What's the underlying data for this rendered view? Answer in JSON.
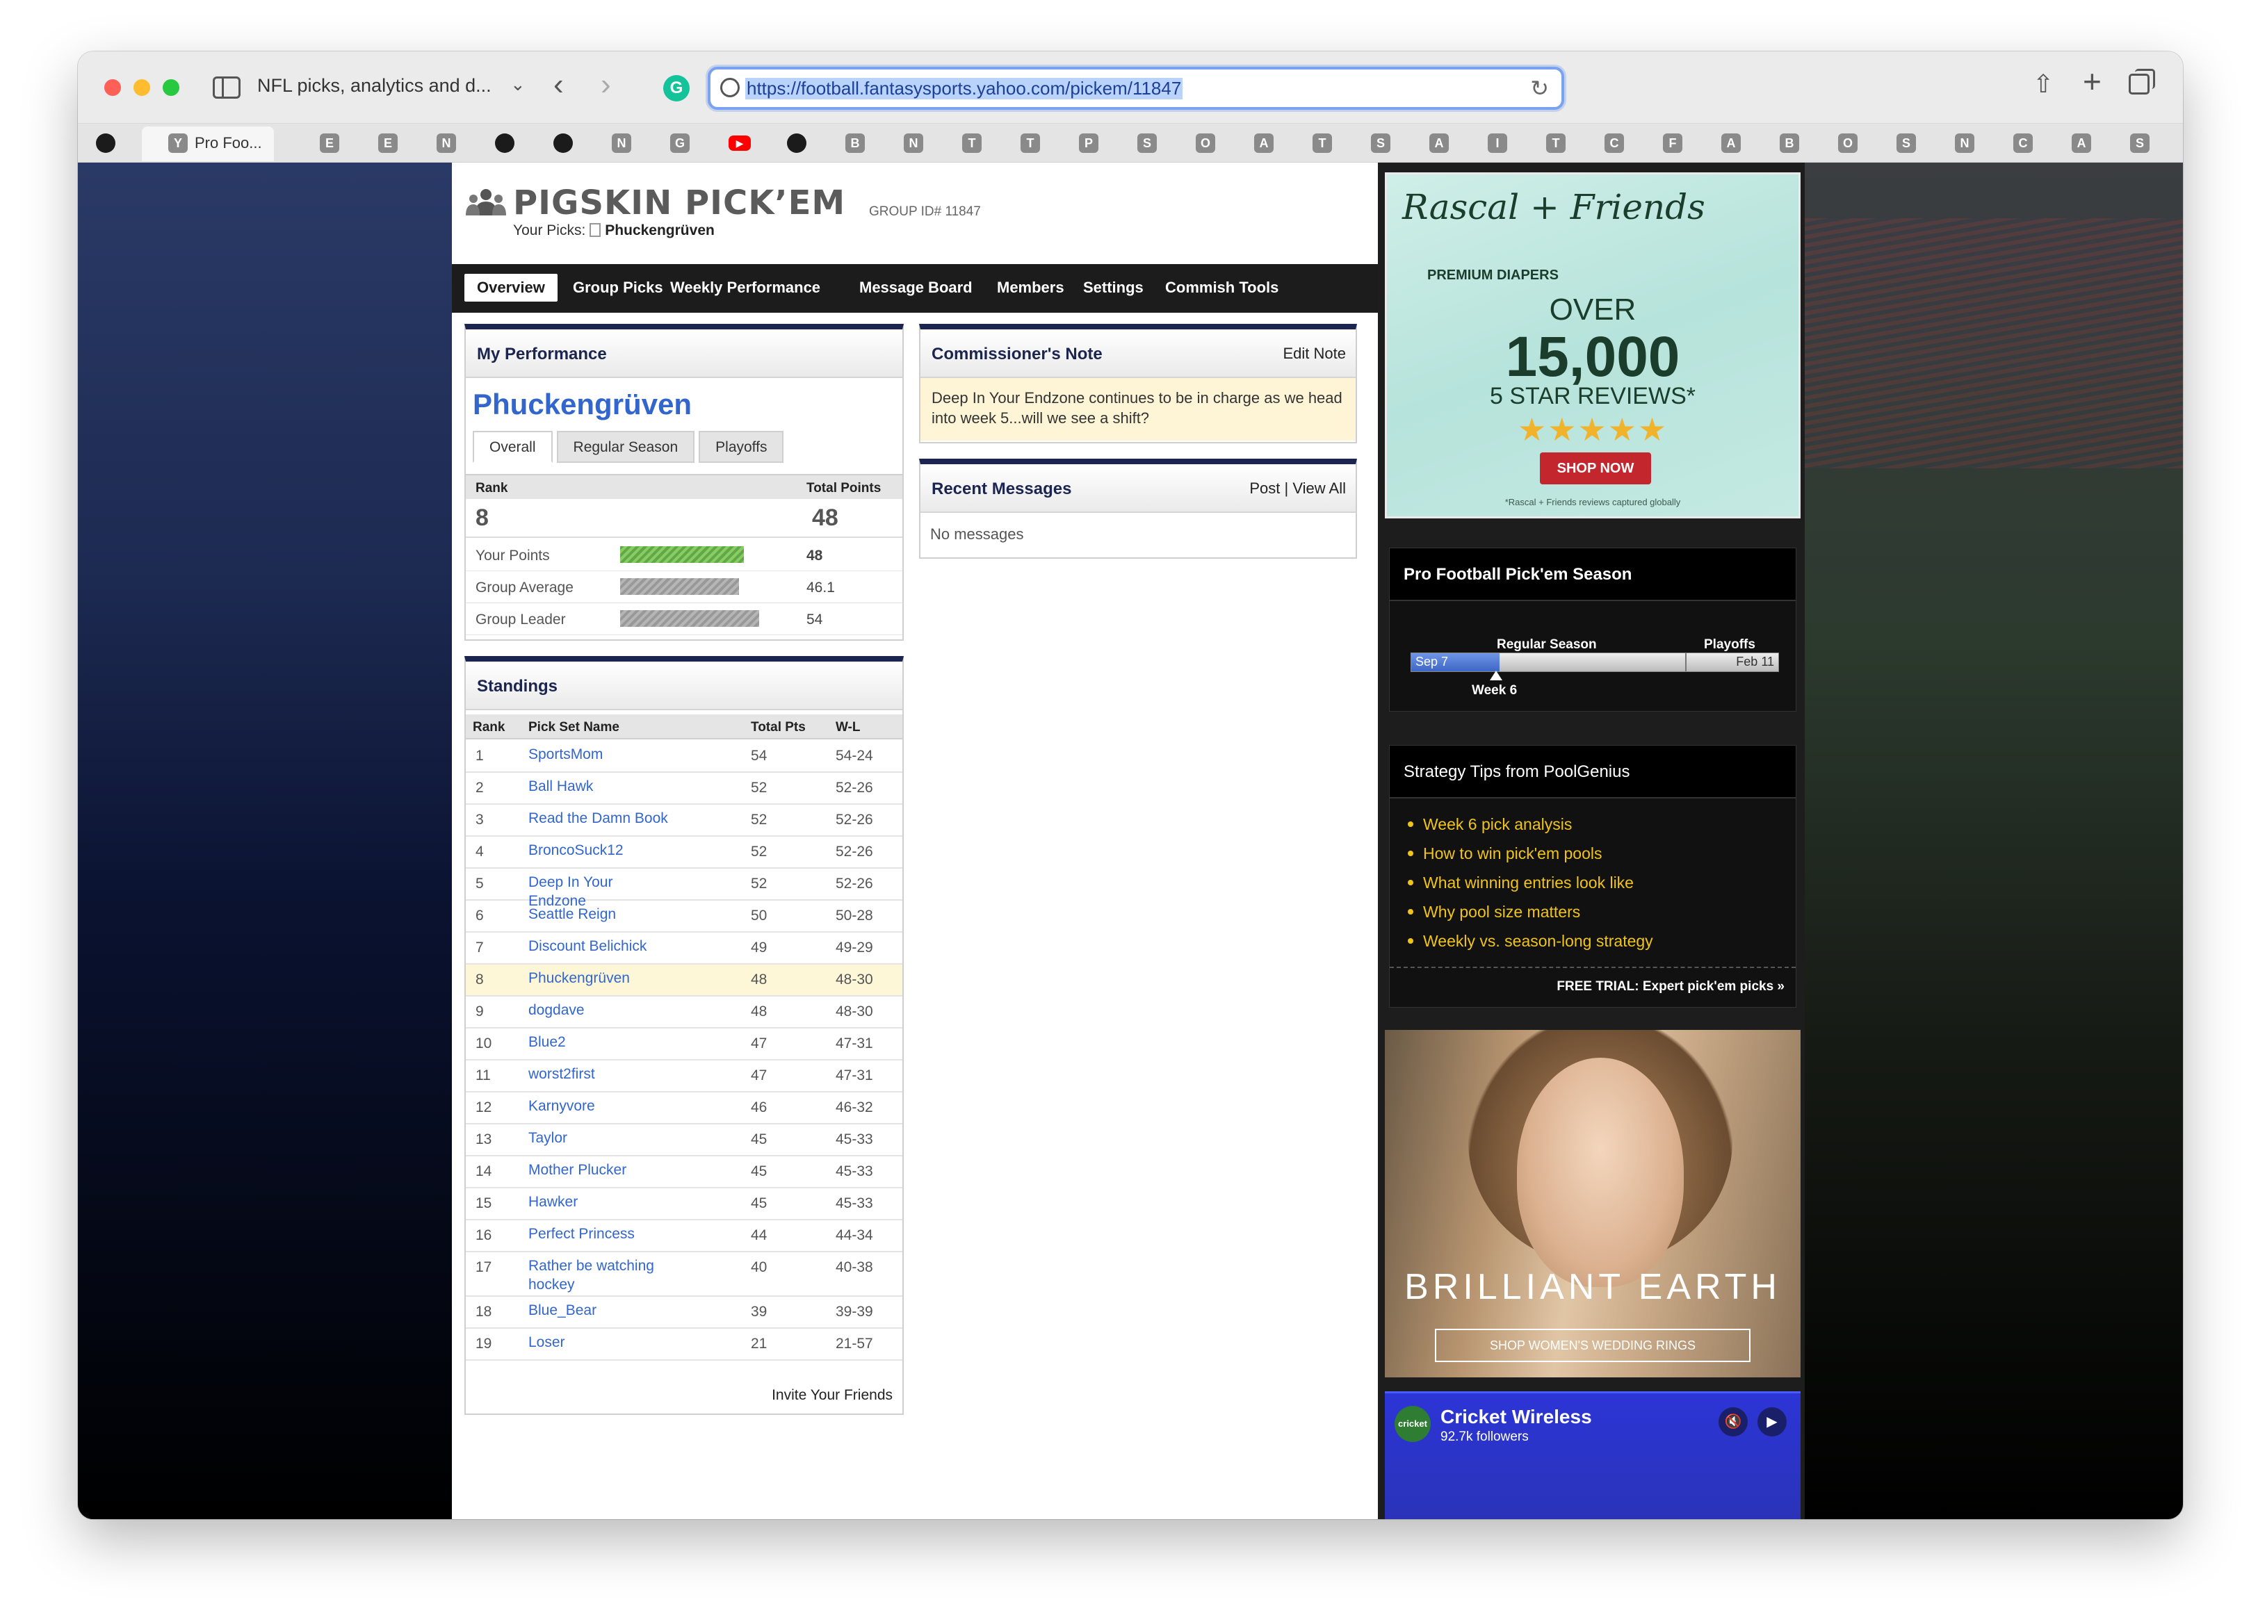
{
  "browser": {
    "window_title": "NFL picks, analytics and d...",
    "url": "https://football.fantasysports.yahoo.com/pickem/11847",
    "active_tab_label": "Pro Foo...",
    "favicons": [
      "gh",
      "Y",
      "E",
      "E",
      "N",
      "gh",
      "gh",
      "N",
      "G",
      "yt",
      "gh",
      "B",
      "N",
      "T",
      "T",
      "P",
      "S",
      "O",
      "A",
      "T",
      "S",
      "A",
      "I",
      "T",
      "C",
      "F",
      "A",
      "B",
      "O",
      "S",
      "N",
      "C",
      "A",
      "S"
    ]
  },
  "header": {
    "title": "PIGSKIN PICK’EM",
    "group_id": "GROUP ID# 11847",
    "your_picks_label": "Your Picks:",
    "your_picks_name": "Phuckengrüven"
  },
  "nav": [
    "Overview",
    "Group Picks",
    "Weekly Performance",
    "Message Board",
    "Members",
    "Settings",
    "Commish Tools"
  ],
  "performance": {
    "heading": "My Performance",
    "player": "Phuckengrüven",
    "tabs": [
      "Overall",
      "Regular Season",
      "Playoffs"
    ],
    "col_rank": "Rank",
    "col_total": "Total Points",
    "rank": "8",
    "total": "48",
    "rows": [
      {
        "label": "Your Points",
        "value": "48",
        "pct": 0.89
      },
      {
        "label": "Group Average",
        "value": "46.1",
        "pct": 0.854
      },
      {
        "label": "Group Leader",
        "value": "54",
        "pct": 1.0
      }
    ]
  },
  "standings": {
    "heading": "Standings",
    "cols": [
      "Rank",
      "Pick Set Name",
      "Total Pts",
      "W-L"
    ],
    "rows": [
      {
        "rank": "1",
        "name": "SportsMom",
        "pts": "54",
        "wl": "54-24"
      },
      {
        "rank": "2",
        "name": "Ball Hawk",
        "pts": "52",
        "wl": "52-26"
      },
      {
        "rank": "3",
        "name": "Read the Damn Book",
        "pts": "52",
        "wl": "52-26"
      },
      {
        "rank": "4",
        "name": "BroncoSuck12",
        "pts": "52",
        "wl": "52-26"
      },
      {
        "rank": "5",
        "name": "Deep In Your Endzone",
        "pts": "52",
        "wl": "52-26"
      },
      {
        "rank": "6",
        "name": "Seattle Reign",
        "pts": "50",
        "wl": "50-28"
      },
      {
        "rank": "7",
        "name": "Discount Belichick",
        "pts": "49",
        "wl": "49-29"
      },
      {
        "rank": "8",
        "name": "Phuckengrüven",
        "pts": "48",
        "wl": "48-30"
      },
      {
        "rank": "9",
        "name": "dogdave",
        "pts": "48",
        "wl": "48-30"
      },
      {
        "rank": "10",
        "name": "Blue2",
        "pts": "47",
        "wl": "47-31"
      },
      {
        "rank": "11",
        "name": "worst2first",
        "pts": "47",
        "wl": "47-31"
      },
      {
        "rank": "12",
        "name": "Karnyvore",
        "pts": "46",
        "wl": "46-32"
      },
      {
        "rank": "13",
        "name": "Taylor",
        "pts": "45",
        "wl": "45-33"
      },
      {
        "rank": "14",
        "name": "Mother Plucker",
        "pts": "45",
        "wl": "45-33"
      },
      {
        "rank": "15",
        "name": "Hawker",
        "pts": "45",
        "wl": "45-33"
      },
      {
        "rank": "16",
        "name": "Perfect Princess",
        "pts": "44",
        "wl": "44-34"
      },
      {
        "rank": "17",
        "name": "Rather be watching hockey",
        "pts": "40",
        "wl": "40-38"
      },
      {
        "rank": "18",
        "name": "Blue_Bear",
        "pts": "39",
        "wl": "39-39"
      },
      {
        "rank": "19",
        "name": "Loser",
        "pts": "21",
        "wl": "21-57"
      }
    ],
    "invite": "Invite Your Friends"
  },
  "commissioner": {
    "heading": "Commissioner's Note",
    "edit": "Edit Note",
    "note": "Deep In Your Endzone continues to be in charge as we head into week 5...will we see a shift?"
  },
  "messages": {
    "heading": "Recent Messages",
    "post": "Post",
    "sep": "|",
    "view_all": "View All",
    "empty": "No messages"
  },
  "ad_diapers": {
    "brand": "Rascal + Friends",
    "sub": "PREMIUM DIAPERS",
    "over": "OVER",
    "count": "15,000",
    "reviews": "5 STAR REVIEWS*",
    "stars": "★★★★★",
    "cta": "SHOP NOW",
    "fine": "*Rascal + Friends reviews captured globally"
  },
  "season": {
    "heading": "Pro Football Pick'em Season",
    "regular": "Regular Season",
    "playoffs": "Playoffs",
    "start": "Sep 7",
    "end": "Feb 11",
    "week": "Week 6",
    "progress": 0.24
  },
  "tips": {
    "heading": "Strategy Tips from PoolGenius",
    "items": [
      "Week 6 pick analysis",
      "How to win pick'em pools",
      "What winning entries look like",
      "Why pool size matters",
      "Weekly vs. season-long strategy"
    ],
    "trial": "FREE TRIAL: Expert pick'em picks »"
  },
  "ad_jewelry": {
    "brand": "BRILLIANT EARTH",
    "cta": "SHOP WOMEN'S WEDDING RINGS"
  },
  "ad_video": {
    "logo": "cricket",
    "name": "Cricket Wireless",
    "followers": "92.7k followers"
  }
}
